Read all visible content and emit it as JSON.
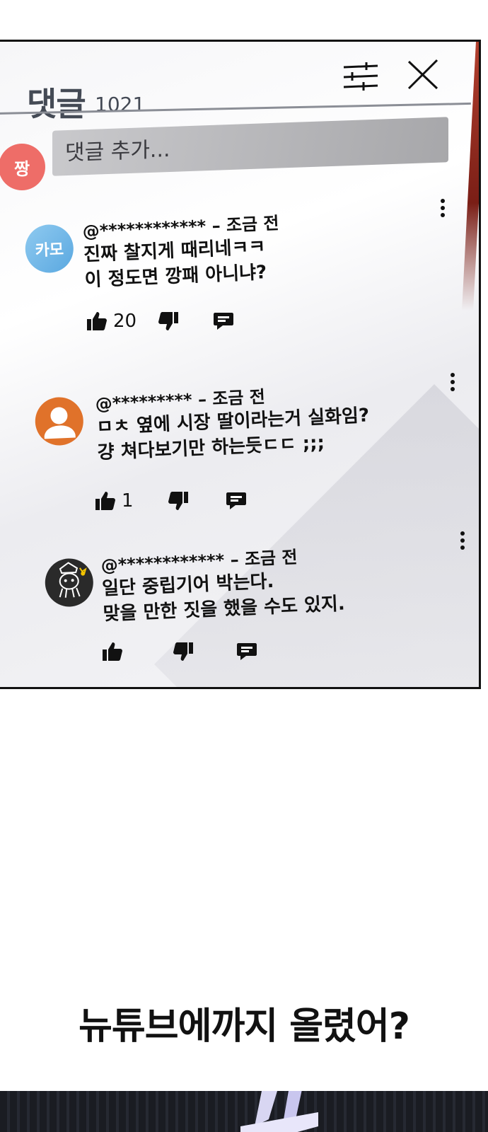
{
  "panel": {
    "title": "댓글",
    "count": "1021",
    "filter_icon": "sliders-icon",
    "close_icon": "close-icon"
  },
  "composer": {
    "avatar_text": "짱",
    "placeholder": "댓글 추가..."
  },
  "comments": [
    {
      "avatar_text": "카모",
      "author": "@************",
      "time": "– 조금 전",
      "lines": [
        "진짜 찰지게 때리네ㅋㅋ",
        "이 정도면 깡패 아니냐?"
      ],
      "likes": "20"
    },
    {
      "avatar_text": "",
      "author": "@*********",
      "time": "– 조금 전",
      "lines": [
        "ㅁㅊ 옆에 시장 딸이라는거 실화임?",
        "걍 쳐다보기만 하는듯ㄷㄷ ;;;"
      ],
      "likes": "1"
    },
    {
      "avatar_text": "",
      "author": "@************",
      "time": "– 조금 전",
      "lines": [
        "일단 중립기어 박는다.",
        "맞을 만한 짓을 했을 수도 있지."
      ],
      "likes": ""
    }
  ],
  "caption": "뉴튜브에까지 올렸어?",
  "colors": {
    "me_avatar": "#ee6d68",
    "kamo_avatar": "#6cb6e8",
    "person_avatar": "#e0722a",
    "squid_avatar": "#2a2a2a"
  }
}
